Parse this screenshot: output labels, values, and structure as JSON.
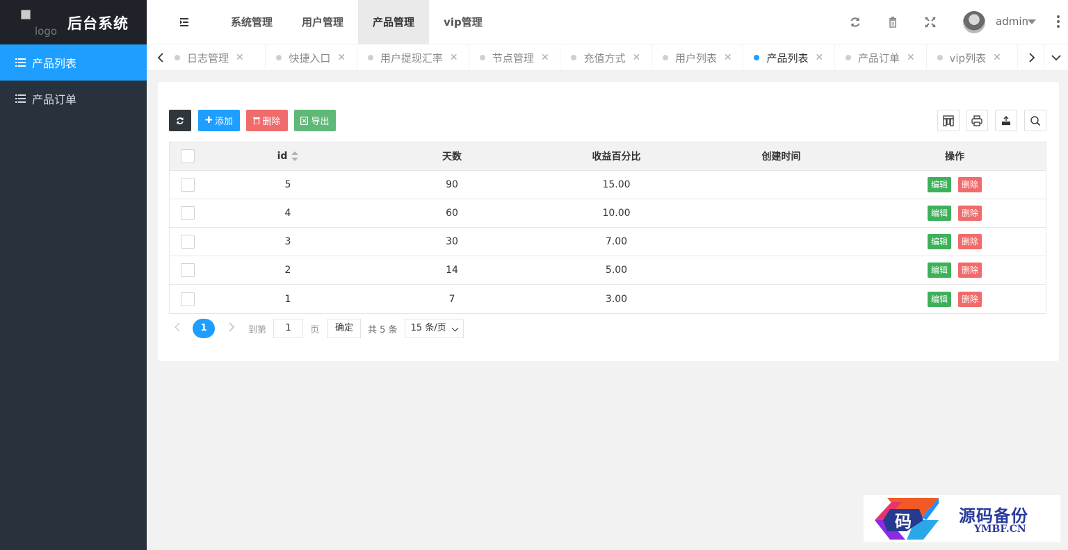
{
  "app": {
    "logo_alt": "logo",
    "title": "后台系统"
  },
  "sidebar": {
    "items": [
      {
        "label": "产品列表"
      },
      {
        "label": "产品订单"
      }
    ]
  },
  "topnav": {
    "items": [
      {
        "label": "系统管理"
      },
      {
        "label": "用户管理"
      },
      {
        "label": "产品管理"
      },
      {
        "label": "vip管理"
      }
    ],
    "active": "产品管理"
  },
  "header": {
    "user": "admin",
    "icons": [
      "refresh-icon",
      "trash-icon",
      "fullscreen-icon",
      "more-icon"
    ]
  },
  "tabs": [
    {
      "label": "日志管理"
    },
    {
      "label": "快捷入口"
    },
    {
      "label": "用户提现汇率"
    },
    {
      "label": "节点管理"
    },
    {
      "label": "充值方式"
    },
    {
      "label": "用户列表"
    },
    {
      "label": "产品列表"
    },
    {
      "label": "产品订单"
    },
    {
      "label": "vip列表"
    }
  ],
  "active_tab": "产品列表",
  "toolbar": {
    "add": "添加",
    "delete": "删除",
    "export": "导出",
    "right_icons": [
      "columns-icon",
      "print-icon",
      "export-icon",
      "search-icon"
    ]
  },
  "table": {
    "headers": {
      "id": "id",
      "days": "天数",
      "pct": "收益百分比",
      "time": "创建时间",
      "ops": "操作"
    },
    "rows": [
      {
        "id": "5",
        "days": "90",
        "pct": "15.00",
        "time": ""
      },
      {
        "id": "4",
        "days": "60",
        "pct": "10.00",
        "time": ""
      },
      {
        "id": "3",
        "days": "30",
        "pct": "7.00",
        "time": ""
      },
      {
        "id": "2",
        "days": "14",
        "pct": "5.00",
        "time": ""
      },
      {
        "id": "1",
        "days": "7",
        "pct": "3.00",
        "time": ""
      }
    ],
    "edit_label": "编辑",
    "delete_label": "删除"
  },
  "pager": {
    "current": "1",
    "goto_prefix": "到第",
    "goto_value": "1",
    "goto_suffix": "页",
    "confirm": "确定",
    "total": "共 5 条",
    "page_size": "15 条/页"
  },
  "watermark": {
    "cn": "源码备份",
    "en": "YMBF.CN",
    "glyph": "码"
  },
  "colors": {
    "primary": "#1e9fff",
    "sidebar": "#28323c",
    "danger": "#f06b6b",
    "success": "#3db05a",
    "export": "#5fb878",
    "dark": "#2f363c"
  }
}
